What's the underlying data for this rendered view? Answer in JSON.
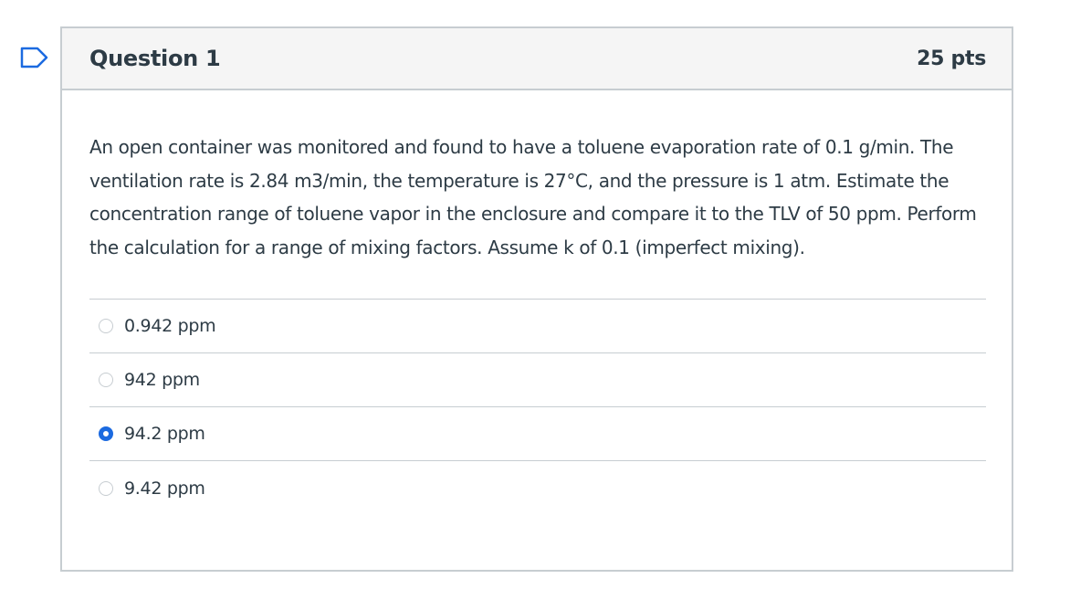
{
  "question": {
    "title": "Question 1",
    "points": "25 pts",
    "text": "An open container was monitored and found to have a toluene evaporation rate of 0.1 g/min. The ventilation rate is 2.84 m3/min, the temperature is 27°C, and the pressure is 1 atm. Estimate the concentration range of toluene vapor in the enclosure and compare it to the TLV of 50 ppm. Perform the calculation for a range of mixing factors. Assume k of 0.1 (imperfect mixing).",
    "answers": [
      {
        "label": "0.942 ppm",
        "selected": false
      },
      {
        "label": "942 ppm",
        "selected": false
      },
      {
        "label": "94.2 ppm",
        "selected": true
      },
      {
        "label": "9.42 ppm",
        "selected": false
      }
    ]
  },
  "icons": {
    "flag": "flag-question-icon"
  },
  "colors": {
    "text": "#2d3b45",
    "border": "#c7cdd1",
    "header_bg": "#f5f5f5",
    "selected_radio": "#1b6ae0",
    "flag": "#1b6ae0"
  }
}
